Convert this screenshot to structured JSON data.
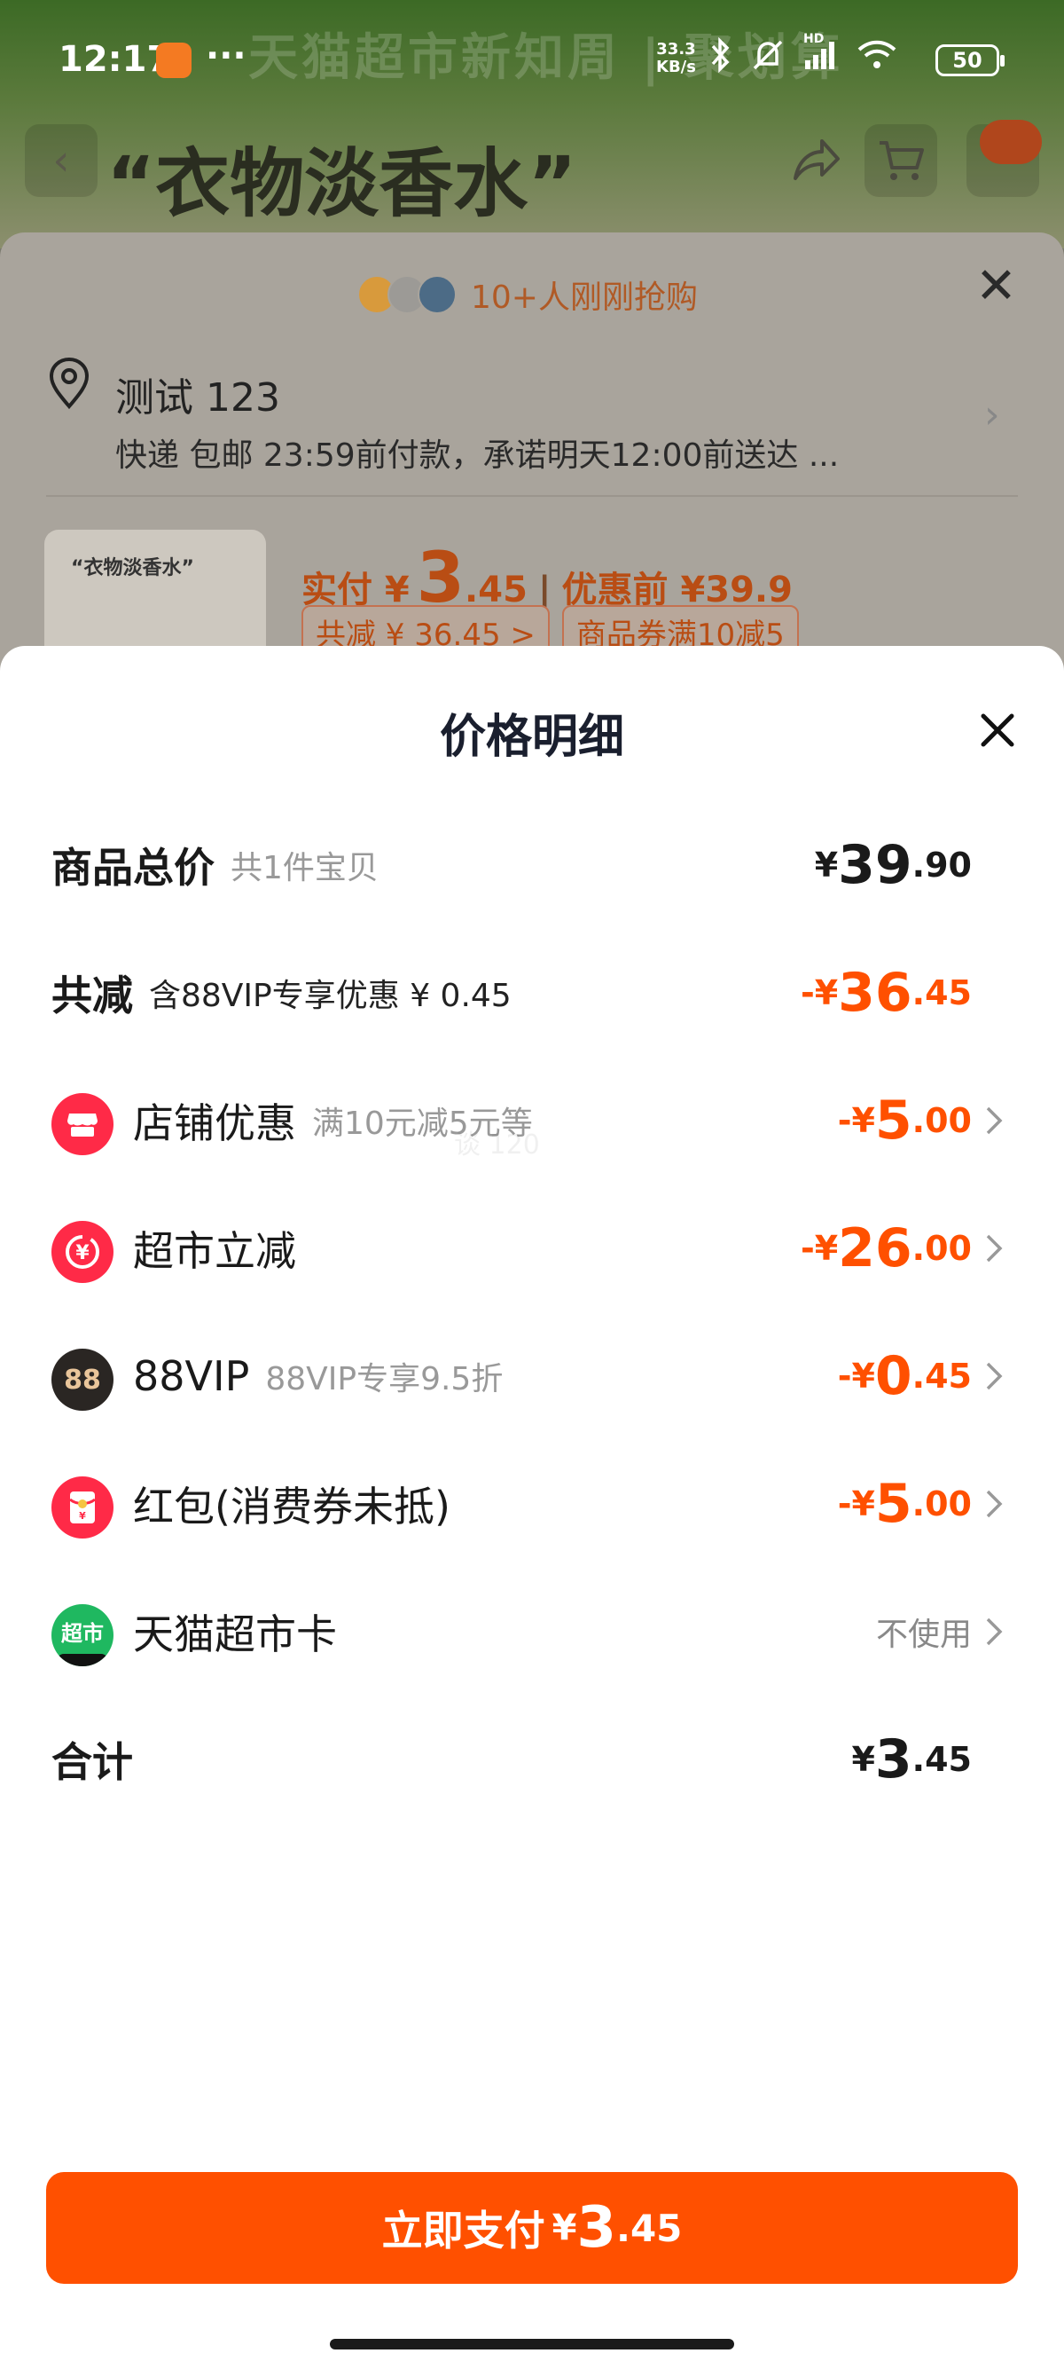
{
  "status_bar": {
    "time": "12:17",
    "more": "···",
    "net_speed_value": "33.3",
    "net_speed_unit": "KB/s",
    "signal_badge": "HD",
    "battery": "50"
  },
  "background": {
    "banner_text": "天猫超市新知周 | 聚划算",
    "product_title": "“衣物淡香水”",
    "recent_buyers": "10+人刚刚抢购",
    "address_name": "测试 123",
    "delivery_desc": "快递 包邮 23:59前付款，承诺明天12:00前送达 ...",
    "thumb_text": "“衣物淡香水”",
    "price_label": "实付 ¥",
    "price_int": "3",
    "price_dec": ".45",
    "price_sep": "|",
    "price_before": "优惠前 ¥39.9",
    "tag_total_off": "共减 ¥ 36.45 >",
    "tag_coupon": "商品券满10减5"
  },
  "modal": {
    "title": "价格明细",
    "rows": [
      {
        "label": "商品总价",
        "sub": "共1件宝贝",
        "sym": "¥",
        "int": "39",
        "dec": ".90"
      },
      {
        "label": "共减",
        "sub": "含88VIP专享优惠 ¥ 0.45",
        "sym": "-¥",
        "int": "36",
        "dec": ".45"
      },
      {
        "label": "店铺优惠",
        "sub": "满10元减5元等",
        "sym": "-¥",
        "int": "5",
        "dec": ".00",
        "icon": "shop-icon"
      },
      {
        "label": "超市立减",
        "sub": "",
        "sym": "-¥",
        "int": "26",
        "dec": ".00",
        "icon": "yen-discount-icon"
      },
      {
        "label": "88VIP",
        "sub": "88VIP专享9.5折",
        "sym": "-¥",
        "int": "0",
        "dec": ".45",
        "icon": "vip88-icon"
      },
      {
        "label": "红包(消费券未抵)",
        "sub": "",
        "sym": "-¥",
        "int": "5",
        "dec": ".00",
        "icon": "red-envelope-icon"
      },
      {
        "label": "天猫超市卡",
        "sub": "",
        "value_text": "不使用",
        "icon": "tmall-card-icon"
      },
      {
        "label": "合计",
        "sub": "",
        "sym": "¥",
        "int": "3",
        "dec": ".45"
      }
    ],
    "icon_texts": {
      "vip88": "88",
      "card": "超市",
      "envelope": "¥"
    },
    "watermark": "谈 120",
    "pay_button": {
      "label": "立即支付",
      "sym": "¥",
      "int": "3",
      "dec": ".45"
    }
  },
  "colors": {
    "accent": "#ff5000",
    "shop_red": "#ff2a47",
    "vip_dark": "#2a2623",
    "card_green": "#1fb860"
  }
}
